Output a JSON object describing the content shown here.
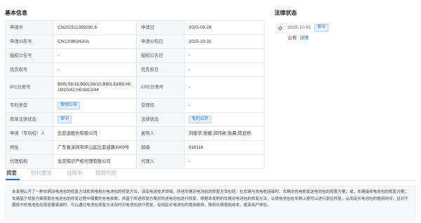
{
  "basic_info": {
    "title": "基本信息",
    "rows": [
      {
        "l1": "申请号",
        "v1": "CN202511399290.6",
        "l2": "申请日",
        "v2": "2025-09-28"
      },
      {
        "l1": "申请公布号",
        "v1": "CN120863420A",
        "l2": "申请公布日",
        "v2": "2025-10-31"
      },
      {
        "l1": "授权公告号",
        "v1": "-",
        "l2": "授权公告日",
        "v2": "-"
      },
      {
        "l1": "优先权号",
        "v1": "-",
        "l2": "优先权日",
        "v2": "-"
      },
      {
        "l1": "IPC分类号",
        "v1": "B60L58/16;B60L58/10;B60L53/66;H01M10/42;H01M10/44",
        "l2": "CPC分类号",
        "v2": "-"
      },
      {
        "l1": "专利类型",
        "v1": "发明公布",
        "l2": "受理局",
        "v2": "-"
      },
      {
        "l1": "简单法律状态",
        "v1": "审中",
        "l2": "法律状态",
        "v2": "专利公开"
      },
      {
        "l1": "申请（专利权）人",
        "v1": "比亚迪股份有限公司",
        "l2": "发明人",
        "v2": "刘俊华;徐媛;邱伟彬;张晨;陈武桥"
      },
      {
        "l1": "地址",
        "v1": "广东省深圳市坪山区比亚迪路3009号",
        "l2": "邮编",
        "v2": "518118"
      },
      {
        "l1": "代理机构",
        "v1": "北京知识产权代理有限公司",
        "l2": "代理人",
        "v2": "-"
      }
    ]
  },
  "legal_status": {
    "title": "法律状态",
    "date": "2025-10-31",
    "status_tag": "审中",
    "event": "公布",
    "detail_link": "详情"
  },
  "tabs": [
    {
      "label": "摘要"
    },
    {
      "label": "权利要求"
    },
    {
      "label": "说明书"
    },
    {
      "label": "摘要附图"
    }
  ],
  "abstract": {
    "text": "本发明公开了一种车辆对电池包的修复方法和充电桩对电池包的修复方法，涉及电池技术领域，所述车辆对电池包的修复方法包括：在车辆与充电桩连接时，车辆向充电桩发送电池包的修复方案；或，车辆接收电池包的修复方案；车辆基于修复方案获取在电池包的修复过程中需要的充电参数，并基于所述修复方案对所述电池包进行修复。根据本发明的车辆对电池包的修复方法，以使电池包在车辆上便可以进行原位修复，从而延长电池包的使用时间，且对于服役中的电池包出现容量衰减时，可以通过电池包修复方法及时对电池包进行修复，有效延长电池包的使用寿命，降低车辆使用成本，提高用户体验。"
  },
  "colors": {
    "accent": "#1e6fd9",
    "label_bg": "#f5f7fa",
    "border": "#e6e9ef"
  }
}
